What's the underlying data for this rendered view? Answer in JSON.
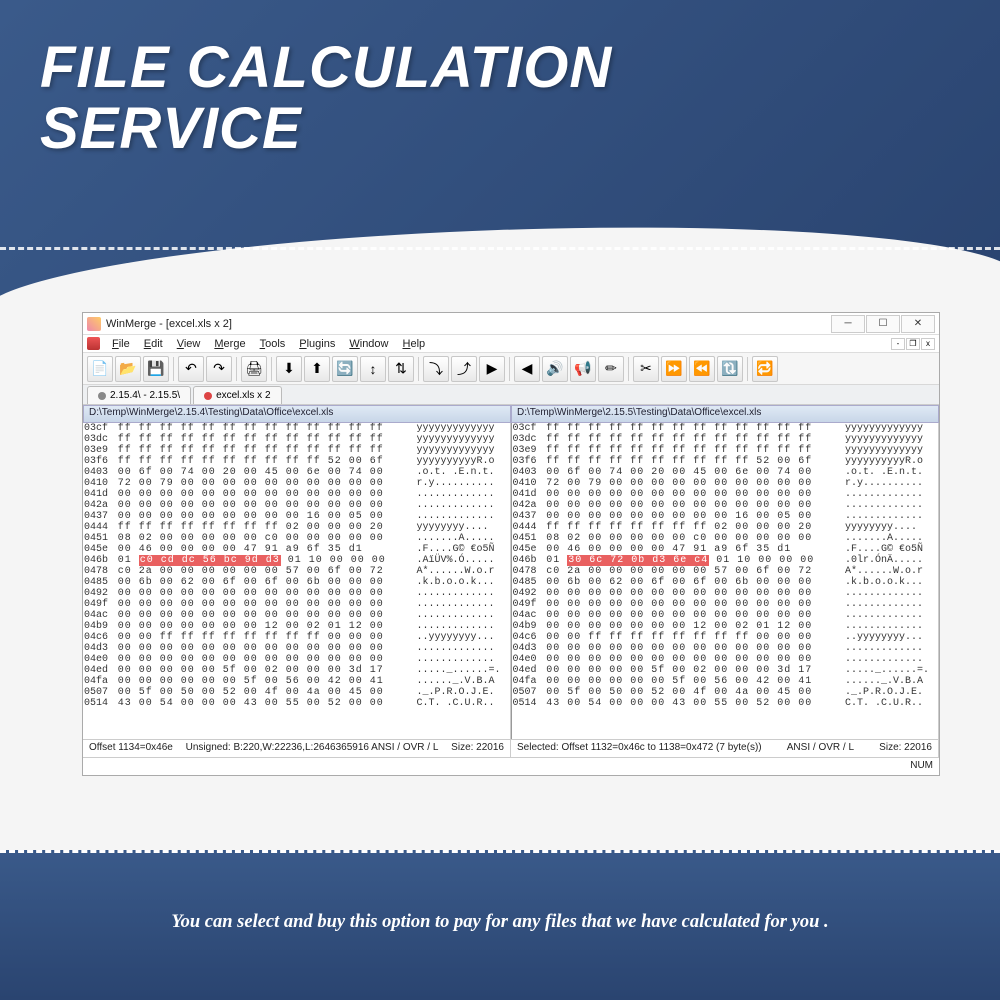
{
  "banner": {
    "line1": "FILE CALCULATION",
    "line2": "SERVICE"
  },
  "window": {
    "title": "WinMerge - [excel.xls x 2]",
    "menus": [
      "File",
      "Edit",
      "View",
      "Merge",
      "Tools",
      "Plugins",
      "Window",
      "Help"
    ],
    "tabs": [
      {
        "label": "2.15.4\\ - 2.15.5\\",
        "dot": "grey"
      },
      {
        "label": "excel.xls x 2",
        "dot": "red"
      }
    ],
    "pathLeft": "D:\\Temp\\WinMerge\\2.15.4\\Testing\\Data\\Office\\excel.xls",
    "pathRight": "D:\\Temp\\WinMerge\\2.15.5\\Testing\\Data\\Office\\excel.xls",
    "statusLeft": {
      "a": "Offset 1134=0x46e",
      "b": "Unsigned: B:220,W:22236,L:2646365916   ANSI / OVR / L",
      "c": "Size: 22016"
    },
    "statusRight": {
      "a": "Selected: Offset 1132=0x46c to 1138=0x472 (7 byte(s))",
      "b": "ANSI / OVR / L",
      "c": "Size: 22016"
    },
    "status2": "NUM",
    "hexLeft": [
      {
        "off": "03cf",
        "hx": "ff ff ff ff ff ff ff ff ff ff ff ff ff",
        "asc": "yyyyyyyyyyyyy"
      },
      {
        "off": "03dc",
        "hx": "ff ff ff ff ff ff ff ff ff ff ff ff ff",
        "asc": "yyyyyyyyyyyyy"
      },
      {
        "off": "03e9",
        "hx": "ff ff ff ff ff ff ff ff ff ff ff ff ff",
        "asc": "yyyyyyyyyyyyy"
      },
      {
        "off": "03f6",
        "hx": "ff ff ff ff ff ff ff ff ff ff 52 00 6f",
        "asc": "yyyyyyyyyyR.o"
      },
      {
        "off": "0403",
        "hx": "00 6f 00 74 00 20 00 45 00 6e 00 74 00",
        "asc": ".o.t. .E.n.t."
      },
      {
        "off": "0410",
        "hx": "72 00 79 00 00 00 00 00 00 00 00 00 00",
        "asc": "r.y.........."
      },
      {
        "off": "041d",
        "hx": "00 00 00 00 00 00 00 00 00 00 00 00 00",
        "asc": "............."
      },
      {
        "off": "042a",
        "hx": "00 00 00 00 00 00 00 00 00 00 00 00 00",
        "asc": "............."
      },
      {
        "off": "0437",
        "hx": "00 00 00 00 00 00 00 00 00 16 00 05 00",
        "asc": "............."
      },
      {
        "off": "0444",
        "hx": "ff ff ff ff ff ff ff ff 02 00 00 00 20",
        "asc": "yyyyyyyy.... "
      },
      {
        "off": "0451",
        "hx": "08 02 00 00 00 00 00 c0 00 00 00 00 00",
        "asc": ".......A....."
      },
      {
        "off": "045e",
        "hx": "00 46 00 00 00 00 47 91 a9 6f 35 d1",
        "asc": ".F....G© €o5Ñ"
      },
      {
        "off": "046b",
        "hl": "01 c0 cd dc 56 bc 9d d3",
        "hx2": "01 10 00 00 00",
        "asc": ".AïÜV%.Ó....."
      },
      {
        "off": "0478",
        "hx": "c0 2a 00 00 00 00 00 00 57 00 6f 00 72",
        "asc": "A*......W.o.r"
      },
      {
        "off": "0485",
        "hx": "00 6b 00 62 00 6f 00 6f 00 6b 00 00 00",
        "asc": ".k.b.o.o.k..."
      },
      {
        "off": "0492",
        "hx": "00 00 00 00 00 00 00 00 00 00 00 00 00",
        "asc": "............."
      },
      {
        "off": "049f",
        "hx": "00 00 00 00 00 00 00 00 00 00 00 00 00",
        "asc": "............."
      },
      {
        "off": "04ac",
        "hx": "00 00 00 00 00 00 00 00 00 00 00 00 00",
        "asc": "............."
      },
      {
        "off": "04b9",
        "hx": "00 00 00 00 00 00 00 12 00 02 01 12 00",
        "asc": "............."
      },
      {
        "off": "04c6",
        "hx": "00 00 ff ff ff ff ff ff ff ff 00 00 00",
        "asc": "..yyyyyyyy..."
      },
      {
        "off": "04d3",
        "hx": "00 00 00 00 00 00 00 00 00 00 00 00 00",
        "asc": "............."
      },
      {
        "off": "04e0",
        "hx": "00 00 00 00 00 00 00 00 00 00 00 00 00",
        "asc": "............."
      },
      {
        "off": "04ed",
        "hx": "00 00 00 00 00 5f 00 02 00 00 00 3d 17",
        "asc": "....._......=."
      },
      {
        "off": "04fa",
        "hx": "00 00 00 00 00 00 5f 00 56 00 42 00 41",
        "asc": "......_.V.B.A"
      },
      {
        "off": "0507",
        "hx": "00 5f 00 50 00 52 00 4f 00 4a 00 45 00",
        "asc": "._.P.R.O.J.E."
      },
      {
        "off": "0514",
        "hx": "43 00 54 00 00 00 43 00 55 00 52 00 00",
        "asc": "C.T. .C.U.R.."
      }
    ],
    "hexRight": [
      {
        "off": "03cf",
        "hx": "ff ff ff ff ff ff ff ff ff ff ff ff ff",
        "asc": "yyyyyyyyyyyyy"
      },
      {
        "off": "03dc",
        "hx": "ff ff ff ff ff ff ff ff ff ff ff ff ff",
        "asc": "yyyyyyyyyyyyy"
      },
      {
        "off": "03e9",
        "hx": "ff ff ff ff ff ff ff ff ff ff ff ff ff",
        "asc": "yyyyyyyyyyyyy"
      },
      {
        "off": "03f6",
        "hx": "ff ff ff ff ff ff ff ff ff ff 52 00 6f",
        "asc": "yyyyyyyyyyR.o"
      },
      {
        "off": "0403",
        "hx": "00 6f 00 74 00 20 00 45 00 6e 00 74 00",
        "asc": ".o.t. .E.n.t."
      },
      {
        "off": "0410",
        "hx": "72 00 79 00 00 00 00 00 00 00 00 00 00",
        "asc": "r.y.........."
      },
      {
        "off": "041d",
        "hx": "00 00 00 00 00 00 00 00 00 00 00 00 00",
        "asc": "............."
      },
      {
        "off": "042a",
        "hx": "00 00 00 00 00 00 00 00 00 00 00 00 00",
        "asc": "............."
      },
      {
        "off": "0437",
        "hx": "00 00 00 00 00 00 00 00 00 16 00 05 00",
        "asc": "............."
      },
      {
        "off": "0444",
        "hx": "ff ff ff ff ff ff ff ff 02 00 00 00 20",
        "asc": "yyyyyyyy.... "
      },
      {
        "off": "0451",
        "hx": "08 02 00 00 00 00 00 c0 00 00 00 00 00",
        "asc": ".......A....."
      },
      {
        "off": "045e",
        "hx": "00 46 00 00 00 00 47 91 a9 6f 35 d1",
        "asc": ".F....G© €o5Ñ"
      },
      {
        "off": "046b",
        "hl": "01 30 6c 72 0b d3 6e c4",
        "hx2": "01 10 00 00 00",
        "asc": ".0lr.ÓnÄ....."
      },
      {
        "off": "0478",
        "hx": "c0 2a 00 00 00 00 00 00 57 00 6f 00 72",
        "asc": "A*......W.o.r"
      },
      {
        "off": "0485",
        "hx": "00 6b 00 62 00 6f 00 6f 00 6b 00 00 00",
        "asc": ".k.b.o.o.k..."
      },
      {
        "off": "0492",
        "hx": "00 00 00 00 00 00 00 00 00 00 00 00 00",
        "asc": "............."
      },
      {
        "off": "049f",
        "hx": "00 00 00 00 00 00 00 00 00 00 00 00 00",
        "asc": "............."
      },
      {
        "off": "04ac",
        "hx": "00 00 00 00 00 00 00 00 00 00 00 00 00",
        "asc": "............."
      },
      {
        "off": "04b9",
        "hx": "00 00 00 00 00 00 00 12 00 02 01 12 00",
        "asc": "............."
      },
      {
        "off": "04c6",
        "hx": "00 00 ff ff ff ff ff ff ff ff 00 00 00",
        "asc": "..yyyyyyyy..."
      },
      {
        "off": "04d3",
        "hx": "00 00 00 00 00 00 00 00 00 00 00 00 00",
        "asc": "............."
      },
      {
        "off": "04e0",
        "hx": "00 00 00 00 00 00 00 00 00 00 00 00 00",
        "asc": "............."
      },
      {
        "off": "04ed",
        "hx": "00 00 00 00 00 5f 00 02 00 00 00 3d 17",
        "asc": "....._......=."
      },
      {
        "off": "04fa",
        "hx": "00 00 00 00 00 00 5f 00 56 00 42 00 41",
        "asc": "......_.V.B.A"
      },
      {
        "off": "0507",
        "hx": "00 5f 00 50 00 52 00 4f 00 4a 00 45 00",
        "asc": "._.P.R.O.J.E."
      },
      {
        "off": "0514",
        "hx": "43 00 54 00 00 00 43 00 55 00 52 00 00",
        "asc": "C.T. .C.U.R.."
      }
    ]
  },
  "toolbar_icons": [
    "📄",
    "📂",
    "💾",
    "↶",
    "↷",
    "🖨",
    "⬇",
    "⬆",
    "🔄",
    "↕",
    "⇅",
    "⤵",
    "⤴",
    "▶",
    "◀",
    "🔊",
    "📢",
    "✏",
    "✂",
    "⏩",
    "⏪",
    "🔃",
    "🔁"
  ],
  "footer": "You can select and buy this option to pay for any files that we have calculated for you ."
}
